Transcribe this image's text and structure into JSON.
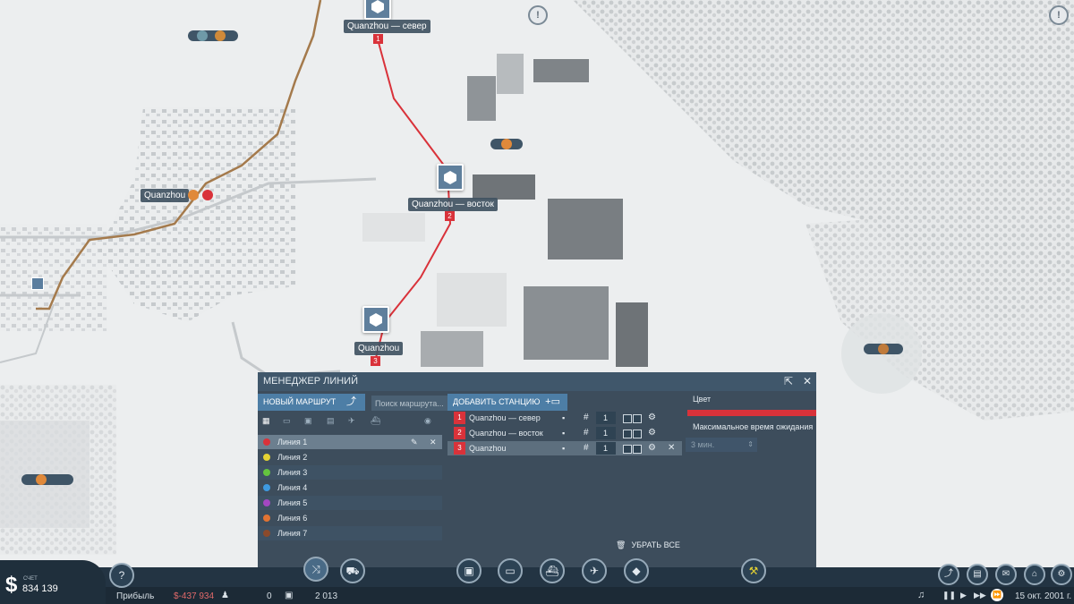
{
  "map": {
    "labels": {
      "north": "Quanzhou — север",
      "east": "Quanzhou — восток",
      "south": "Quanzhou",
      "city": "Quanzhou"
    },
    "stop_numbers": [
      "1",
      "2",
      "3"
    ],
    "alert_icon": "!",
    "route_color": "#d9323a"
  },
  "panel": {
    "title": "МЕНЕДЖЕР ЛИНИЙ",
    "new_route_label": "НОВЫЙ МАРШРУТ",
    "search_placeholder": "Поиск маршрута...",
    "add_station_label": "ДОБАВИТЬ СТАНЦИЮ",
    "lines": [
      {
        "label": "Линия 1",
        "color": "#d9323a"
      },
      {
        "label": "Линия 2",
        "color": "#e4d233"
      },
      {
        "label": "Линия 3",
        "color": "#64c43e"
      },
      {
        "label": "Линия 4",
        "color": "#3e9ae0"
      },
      {
        "label": "Линия 5",
        "color": "#a347c2"
      },
      {
        "label": "Линия 6",
        "color": "#e17332"
      },
      {
        "label": "Линия 7",
        "color": "#8a4a2c"
      }
    ],
    "stops": [
      {
        "num": "1",
        "name": "Quanzhou — север",
        "count": "1"
      },
      {
        "num": "2",
        "name": "Quanzhou — восток",
        "count": "1"
      },
      {
        "num": "3",
        "name": "Quanzhou",
        "count": "1"
      }
    ],
    "remove_all_label": "УБРАТЬ ВСЕ",
    "color_label": "Цвет",
    "max_wait_label": "Максимальное время ожидания",
    "max_wait_value": "3 мин."
  },
  "status": {
    "account_label": "СЧЕТ",
    "balance": "834 139",
    "profit_label": "Прибыль",
    "profit_value": "$-437 934",
    "passengers": "0",
    "cargo": "2 013",
    "date": "15 окт. 2001 г.",
    "help": "?"
  }
}
